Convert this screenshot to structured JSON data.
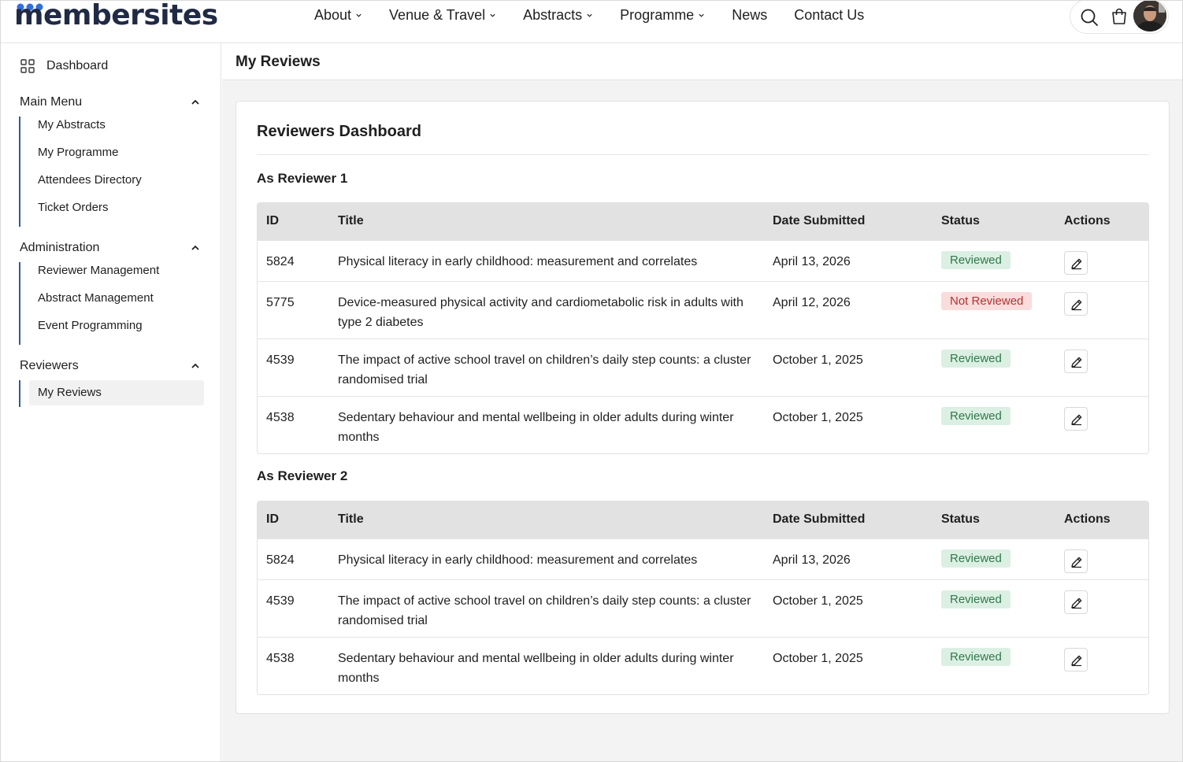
{
  "brand": {
    "logo_text": "membersites"
  },
  "nav": {
    "items": [
      {
        "label": "About",
        "dropdown": true
      },
      {
        "label": "Venue & Travel",
        "dropdown": true
      },
      {
        "label": "Abstracts",
        "dropdown": true
      },
      {
        "label": "Programme",
        "dropdown": true
      },
      {
        "label": "News",
        "dropdown": false
      },
      {
        "label": "Contact Us",
        "dropdown": false
      }
    ],
    "icons": [
      "search-icon",
      "cart-icon",
      "avatar"
    ]
  },
  "sidebar": {
    "dashboard": "Dashboard",
    "sections": [
      {
        "title": "Main Menu",
        "items": [
          "My Abstracts",
          "My Programme",
          "Attendees Directory",
          "Ticket Orders"
        ]
      },
      {
        "title": "Administration",
        "items": [
          "Reviewer Management",
          "Abstract Management",
          "Event Programming"
        ]
      },
      {
        "title": "Reviewers",
        "items": [
          "My Reviews"
        ],
        "active": "My Reviews"
      }
    ]
  },
  "page": {
    "title": "My Reviews"
  },
  "card": {
    "title": "Reviewers Dashboard",
    "columns": {
      "id": "ID",
      "title": "Title",
      "date": "Date Submitted",
      "status": "Status",
      "actions": "Actions"
    },
    "groups": [
      {
        "title": "As Reviewer 1",
        "rows": [
          {
            "id": "5824",
            "title": "Physical literacy in early childhood: measurement and correlates",
            "date": "April 13, 2026",
            "status": "Reviewed"
          },
          {
            "id": "5775",
            "title": "Device-measured physical activity and cardiometabolic risk in adults with type 2 diabetes",
            "date": "April 12, 2026",
            "status": "Not Reviewed"
          },
          {
            "id": "4539",
            "title": "The impact of active school travel on children’s daily step counts: a cluster randomised trial",
            "date": "October 1, 2025",
            "status": "Reviewed"
          },
          {
            "id": "4538",
            "title": "Sedentary behaviour and mental wellbeing in older adults during winter months",
            "date": "October 1, 2025",
            "status": "Reviewed"
          }
        ]
      },
      {
        "title": "As Reviewer 2",
        "rows": [
          {
            "id": "5824",
            "title": "Physical literacy in early childhood: measurement and correlates",
            "date": "April 13, 2026",
            "status": "Reviewed"
          },
          {
            "id": "4539",
            "title": "The impact of active school travel on children’s daily step counts: a cluster randomised trial",
            "date": "October 1, 2025",
            "status": "Reviewed"
          },
          {
            "id": "4538",
            "title": "Sedentary behaviour and mental wellbeing in older adults during winter months",
            "date": "October 1, 2025",
            "status": "Reviewed"
          }
        ]
      }
    ]
  },
  "colors": {
    "accent": "#2c5aa0",
    "reviewed_bg": "#dcefe3",
    "reviewed_fg": "#2f7a4b",
    "not_reviewed_bg": "#f9dcdc",
    "not_reviewed_fg": "#b33232"
  }
}
